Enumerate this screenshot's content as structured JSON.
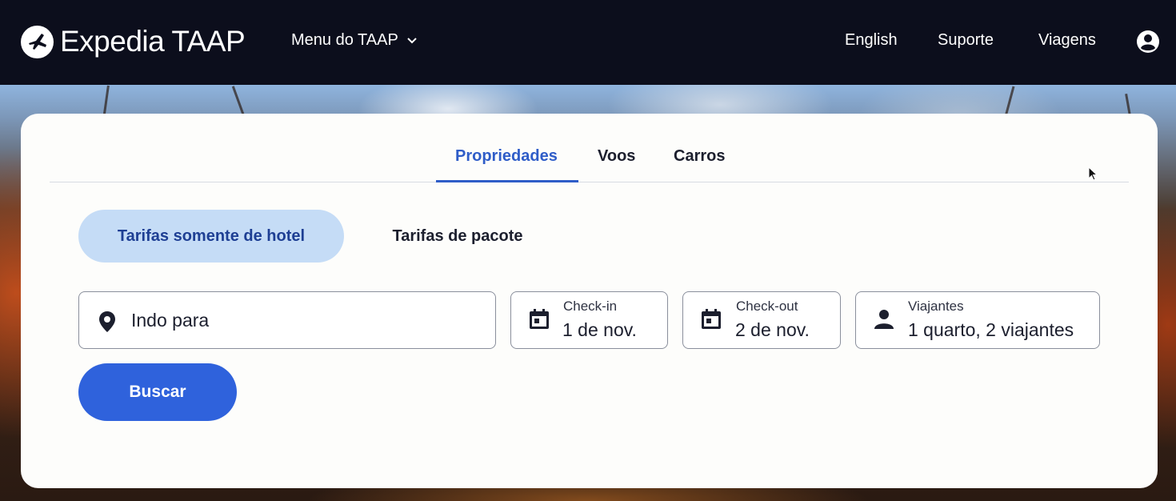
{
  "header": {
    "logo_text": "Expedia TAAP",
    "menu_label": "Menu do TAAP",
    "language": "English",
    "support": "Suporte",
    "trips": "Viagens",
    "icons": {
      "logo": "plane-logo-icon",
      "menu": "chevron-down-icon",
      "account": "account-icon"
    }
  },
  "search": {
    "tabs": [
      {
        "label": "Propriedades",
        "active": true
      },
      {
        "label": "Voos",
        "active": false
      },
      {
        "label": "Carros",
        "active": false
      }
    ],
    "rate_options": [
      {
        "label": "Tarifas somente de hotel",
        "active": true
      },
      {
        "label": "Tarifas de pacote",
        "active": false
      }
    ],
    "destination": {
      "placeholder": "Indo para",
      "icon": "map-pin-icon"
    },
    "checkin": {
      "label": "Check-in",
      "value": "1 de nov.",
      "icon": "calendar-icon"
    },
    "checkout": {
      "label": "Check-out",
      "value": "2 de nov.",
      "icon": "calendar-icon"
    },
    "travelers": {
      "label": "Viajantes",
      "value": "1 quarto, 2 viajantes",
      "icon": "person-icon"
    },
    "submit_label": "Buscar"
  },
  "colors": {
    "header_bg": "#0c0e1c",
    "accent": "#2f5dc8",
    "button": "#2f62dc",
    "pill_active": "#c5dcf6"
  }
}
